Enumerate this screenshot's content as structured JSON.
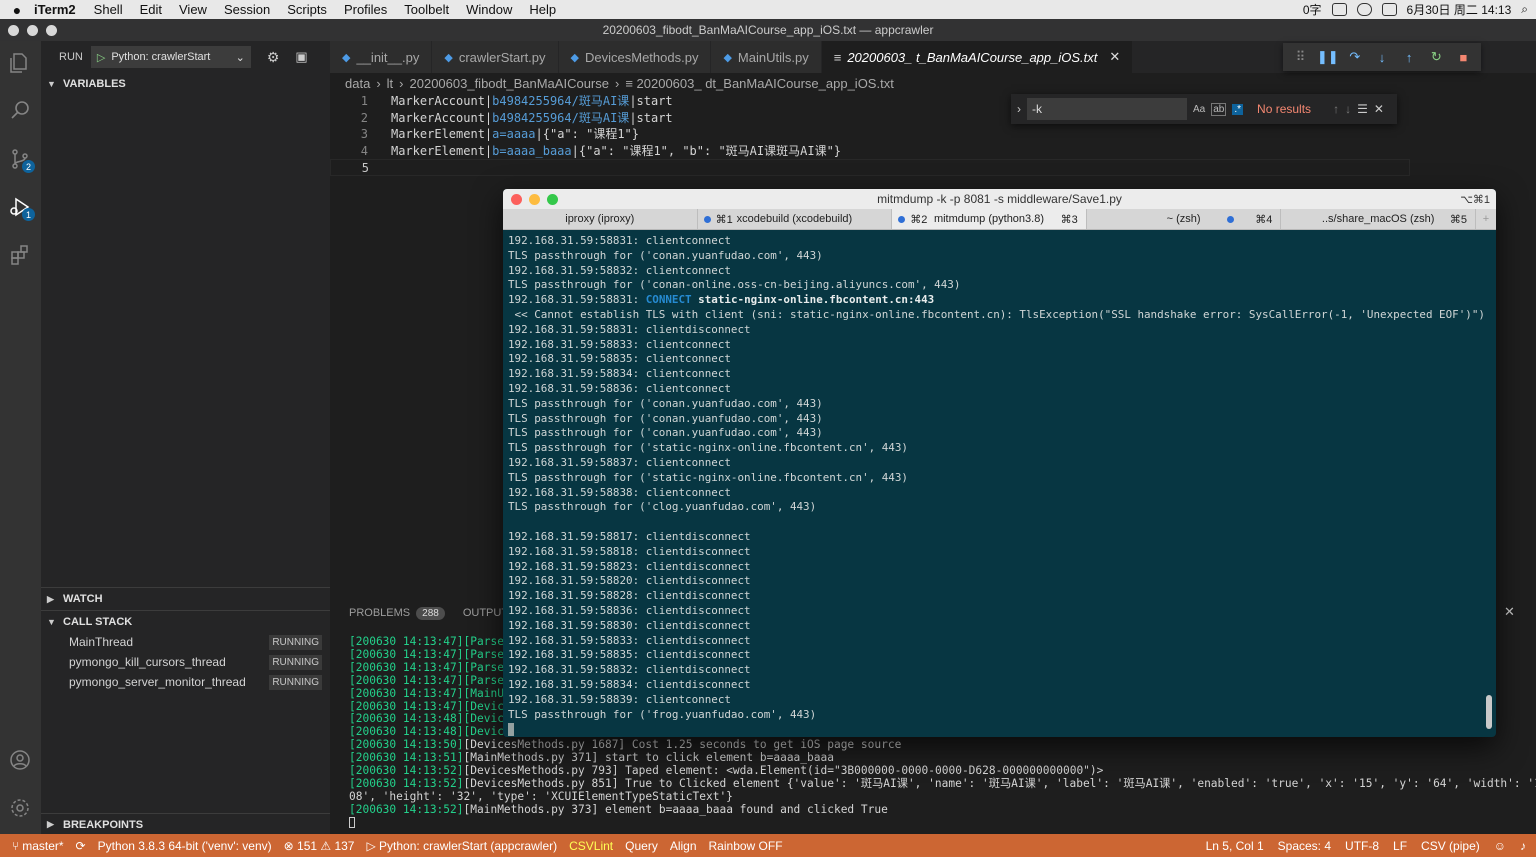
{
  "menubar": {
    "app": "iTerm2",
    "items": [
      "Shell",
      "Edit",
      "View",
      "Session",
      "Scripts",
      "Profiles",
      "Toolbelt",
      "Window",
      "Help"
    ],
    "ime": "0字",
    "datetime": "6月30日 周二  14:13"
  },
  "window": {
    "title": "20200603_fibodt_BanMaAICourse_app_iOS.txt — appcrawler"
  },
  "sidebar": {
    "run_label": "RUN",
    "run_config": "Python: crawlerStart",
    "variables": "VARIABLES",
    "watch": "WATCH",
    "call_stack": "CALL STACK",
    "threads": [
      {
        "name": "MainThread",
        "state": "RUNNING"
      },
      {
        "name": "pymongo_kill_cursors_thread",
        "state": "RUNNING"
      },
      {
        "name": "pymongo_server_monitor_thread",
        "state": "RUNNING"
      }
    ],
    "breakpoints": "BREAKPOINTS"
  },
  "activity": {
    "scm_badge": "2",
    "debug_badge": "1"
  },
  "tabs": [
    {
      "label": "__init__.py",
      "active": false
    },
    {
      "label": "crawlerStart.py",
      "active": false
    },
    {
      "label": "DevicesMethods.py",
      "active": false
    },
    {
      "label": "MainUtils.py",
      "active": false
    },
    {
      "label": "20200603_   t_BanMaAICourse_app_iOS.txt",
      "active": true
    }
  ],
  "breadcrumb": [
    "data",
    "   lt",
    "20200603_fibodt_BanMaAICourse",
    "≡ 20200603_     dt_BanMaAICourse_app_iOS.txt"
  ],
  "editor": {
    "lines": [
      {
        "n": "1",
        "a": "MarkerAccount|",
        "b": "b4984255964/斑马AI课",
        "c": "|start"
      },
      {
        "n": "2",
        "a": "MarkerAccount|",
        "b": "b4984255964/斑马AI课",
        "c": "|start"
      },
      {
        "n": "3",
        "a": "MarkerElement|",
        "b": "a=aaaa",
        "c": "|{\"a\": \"课程1\"}"
      },
      {
        "n": "4",
        "a": "MarkerElement|",
        "b": "b=aaaa_baaa",
        "c": "|{\"a\": \"课程1\", \"b\": \"斑马AI课斑马AI课\"}"
      },
      {
        "n": "5",
        "a": "",
        "b": "",
        "c": ""
      }
    ]
  },
  "find": {
    "value": "-k",
    "opt_case": "Aa",
    "opt_word": "ab",
    "opt_regex": ".*",
    "result": "No results"
  },
  "panel": {
    "tabs": [
      "PROBLEMS",
      "OUTPUT"
    ],
    "problems_count": "288",
    "lines": [
      {
        "p": "[200630 14:13:47]",
        "t": "[ParseP"
      },
      {
        "p": "[200630 14:13:47]",
        "t": "[ParseP"
      },
      {
        "p": "[200630 14:13:47]",
        "t": "[ParseP"
      },
      {
        "p": "[200630 14:13:47]",
        "t": "[ParseP"
      },
      {
        "p": "[200630 14:13:47]",
        "t": "[MainUt"
      },
      {
        "p": "[200630 14:13:47]",
        "t": "[Device"
      },
      {
        "p": "[200630 14:13:48]",
        "t": "[Device"
      },
      {
        "p": "[200630 14:13:48]",
        "t": "[Device"
      },
      {
        "p": "[200630 14:13:50]",
        "t": "[DevicesMethods.py 1687] Cost 1.25 seconds to get iOS page source"
      },
      {
        "p": "[200630 14:13:51]",
        "t": "[MainMethods.py 371] start to click element b=aaaa_baaa"
      },
      {
        "p": "[200630 14:13:52]",
        "t": "[DevicesMethods.py 793] Taped element: <wda.Element(id=\"3B000000-0000-0000-D628-000000000000\")>"
      },
      {
        "p": "[200630 14:13:52]",
        "t": "[DevicesMethods.py 851] True to Clicked element {'value': '斑马AI课', 'name': '斑马AI课', 'label': '斑马AI课', 'enabled': 'true', 'x': '15', 'y': '64', 'width': '1"
      },
      {
        "p": "",
        "t": "08', 'height': '32', 'type': 'XCUIElementTypeStaticText'}"
      },
      {
        "p": "[200630 14:13:52]",
        "t": "[MainMethods.py 373] element b=aaaa_baaa found and clicked True"
      }
    ]
  },
  "statusbar": {
    "branch": "master*",
    "python": "Python 3.8.3 64-bit ('venv': venv)",
    "errors": "⊗ 151 ⚠ 137",
    "debug": "Python: crawlerStart (appcrawler)",
    "csvlint": "CSVLint",
    "query": "Query",
    "align": "Align",
    "rainbow": "Rainbow OFF",
    "position": "Ln 5, Col 1",
    "spaces": "Spaces: 4",
    "encoding": "UTF-8",
    "eol": "LF",
    "lang": "CSV (pipe)"
  },
  "terminal": {
    "title": "mitmdump -k -p 8081 -s middleware/Save1.py",
    "shortcut": "⌥⌘1",
    "tabs": [
      {
        "label": "iproxy (iproxy)",
        "key": "⌘1",
        "dot": true,
        "active": false
      },
      {
        "label": "xcodebuild (xcodebuild)",
        "key": "⌘2",
        "dot": true,
        "active": false
      },
      {
        "label": "mitmdump (python3.8)",
        "key": "⌘3",
        "dot": false,
        "active": true
      },
      {
        "label": "~ (zsh)",
        "key": "⌘4",
        "dot": true,
        "active": false
      },
      {
        "label": "..s/share_macOS (zsh)",
        "key": "⌘5",
        "dot": false,
        "active": false
      }
    ],
    "lines": [
      "192.168.31.59:58831: clientconnect",
      "TLS passthrough for ('conan.yuanfudao.com', 443)",
      "192.168.31.59:58832: clientconnect",
      "TLS passthrough for ('conan-online.oss-cn-beijing.aliyuncs.com', 443)",
      "192.168.31.59:58831: ",
      " << Cannot establish TLS with client (sni: static-nginx-online.fbcontent.cn): TlsException(\"SSL handshake error: SysCallError(-1, 'Unexpected EOF')\")",
      "192.168.31.59:58831: clientdisconnect",
      "192.168.31.59:58833: clientconnect",
      "192.168.31.59:58835: clientconnect",
      "192.168.31.59:58834: clientconnect",
      "192.168.31.59:58836: clientconnect",
      "TLS passthrough for ('conan.yuanfudao.com', 443)",
      "TLS passthrough for ('conan.yuanfudao.com', 443)",
      "TLS passthrough for ('conan.yuanfudao.com', 443)",
      "TLS passthrough for ('static-nginx-online.fbcontent.cn', 443)",
      "192.168.31.59:58837: clientconnect",
      "TLS passthrough for ('static-nginx-online.fbcontent.cn', 443)",
      "192.168.31.59:58838: clientconnect",
      "TLS passthrough for ('clog.yuanfudao.com', 443)",
      "",
      "192.168.31.59:58817: clientdisconnect",
      "192.168.31.59:58818: clientdisconnect",
      "192.168.31.59:58823: clientdisconnect",
      "192.168.31.59:58820: clientdisconnect",
      "192.168.31.59:58828: clientdisconnect",
      "192.168.31.59:58836: clientdisconnect",
      "192.168.31.59:58830: clientdisconnect",
      "192.168.31.59:58833: clientdisconnect",
      "192.168.31.59:58835: clientdisconnect",
      "192.168.31.59:58832: clientdisconnect",
      "192.168.31.59:58834: clientdisconnect",
      "192.168.31.59:58839: clientconnect",
      "TLS passthrough for ('frog.yuanfudao.com', 443)"
    ],
    "connect_keyword": "CONNECT",
    "connect_host": "static-nginx-online.fbcontent.cn:443"
  },
  "colors": {
    "statusbar": "#cc6633",
    "terminal_bg": "#073642",
    "accent": "#0e639c"
  }
}
